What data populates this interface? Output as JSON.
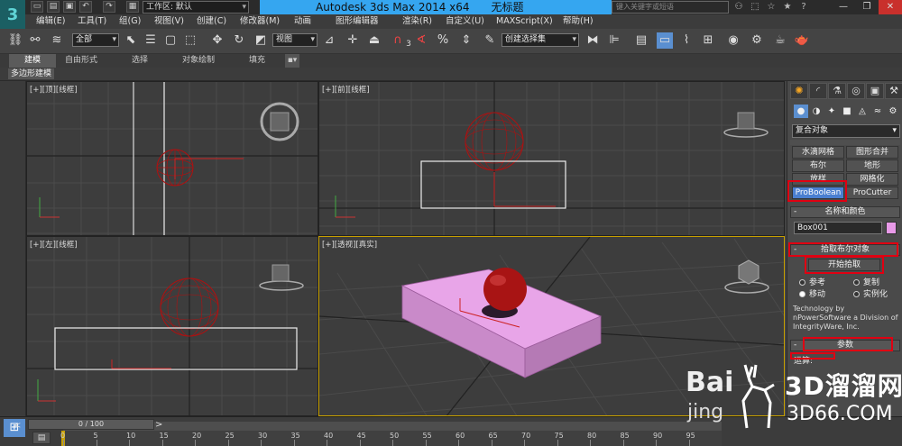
{
  "title": {
    "workspace_label": "工作区: 默认",
    "app_name": "Autodesk 3ds Max  2014 x64",
    "doc_name": "无标题",
    "search_placeholder": "键入关键字或短语"
  },
  "menu": [
    "编辑(E)",
    "工具(T)",
    "组(G)",
    "视图(V)",
    "创建(C)",
    "修改器(M)",
    "动画",
    "图形编辑器",
    "渲染(R)",
    "自定义(U)",
    "MAXScript(X)",
    "帮助(H)"
  ],
  "toolbar": {
    "filter_select": "全部",
    "ref_coord_select": "视图",
    "named_selection": "创建选择集",
    "snap_label": "3",
    "angle_snap": "%"
  },
  "ribbon": {
    "tabs": [
      "建模",
      "自由形式",
      "选择",
      "对象绘制",
      "填充"
    ],
    "subpanel": "多边形建模"
  },
  "viewports": {
    "top": "[+][顶][线框]",
    "front": "[+][前][线框]",
    "left": "[+][左][线框]",
    "persp": "[+][透视][真实]"
  },
  "command_panel": {
    "category": "复合对象",
    "object_types": [
      "水滴网格",
      "图形合并",
      "布尔",
      "地形",
      "放样",
      "网格化",
      "ProBoolean",
      "ProCutter"
    ],
    "name_color_header": "名称和颜色",
    "object_name": "Box001",
    "object_color": "#e89ae8",
    "pick_header": "拾取布尔对象",
    "pick_button": "开始拾取",
    "radio_options": [
      "参考",
      "复制",
      "移动",
      "实例化"
    ],
    "selected_option": "移动",
    "about_text": "Technology by nPowerSoftware a Division of IntegrityWare, Inc.",
    "params_header": "参数",
    "ops_label": "运算:"
  },
  "timeline": {
    "slider": "0 / 100",
    "ticks": [
      "0",
      "5",
      "10",
      "15",
      "20",
      "25",
      "30",
      "35",
      "40",
      "45",
      "50",
      "55",
      "60",
      "65",
      "70",
      "75",
      "80",
      "85",
      "90",
      "95"
    ]
  },
  "watermark": {
    "brand": "3D溜溜网",
    "site": "3D66.COM",
    "baidu": "Bai",
    "jing": "jing"
  },
  "colors": {
    "title_bar_bg": "#35a6f0",
    "highlight_red": "#e00012",
    "sphere_red": "#b01010",
    "box_pink": "#e89ae8",
    "viewport_bg": "#3d3d3d",
    "active_viewport_border": "#c8a000"
  }
}
